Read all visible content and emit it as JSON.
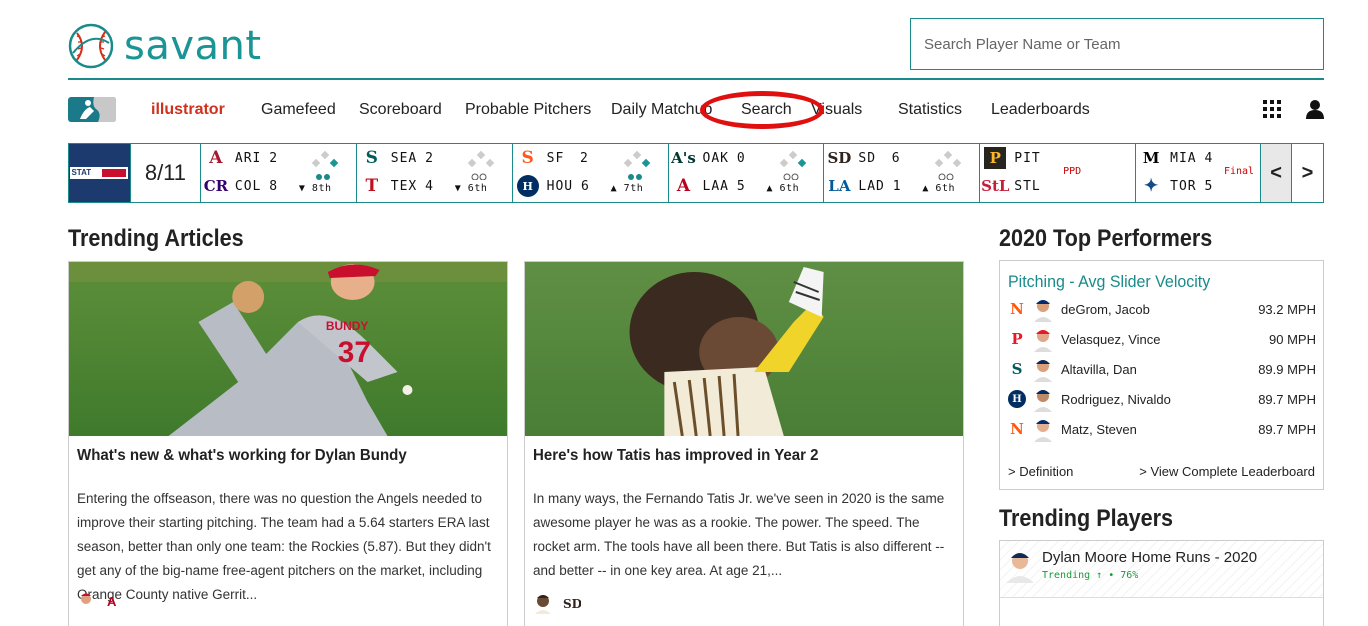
{
  "header": {
    "logo_text": "savant",
    "search_placeholder": "Search Player Name or Team"
  },
  "nav": {
    "items": [
      {
        "label": "illustrator",
        "active": true
      },
      {
        "label": "Gamefeed"
      },
      {
        "label": "Scoreboard"
      },
      {
        "label": "Probable Pitchers"
      },
      {
        "label": "Daily Matchup"
      },
      {
        "label": "Search",
        "highlighted": true
      },
      {
        "label": "Visuals"
      },
      {
        "label": "Statistics"
      },
      {
        "label": "Leaderboards"
      }
    ],
    "accent_color": "#d0301d",
    "highlight_color": "#e01010"
  },
  "scoreboard": {
    "date": "8/11",
    "games": [
      {
        "away": "ARI",
        "away_score": "2",
        "home": "COL",
        "home_score": "8",
        "inning": "▼ 8th"
      },
      {
        "away": "SEA",
        "away_score": "2",
        "home": "TEX",
        "home_score": "4",
        "inning": "▼ 6th"
      },
      {
        "away": "SF",
        "away_score": "2",
        "home": "HOU",
        "home_score": "6",
        "inning": "▲ 7th"
      },
      {
        "away": "OAK",
        "away_score": "0",
        "home": "LAA",
        "home_score": "5",
        "inning": "▲ 6th"
      },
      {
        "away": "SD",
        "away_score": "6",
        "home": "LAD",
        "home_score": "1",
        "inning": "▲ 6th"
      },
      {
        "away": "PIT",
        "away_score": "",
        "home": "STL",
        "home_score": "",
        "status": "PPD"
      },
      {
        "away": "MIA",
        "away_score": "4",
        "home": "TOR",
        "home_score": "5",
        "status": "Final"
      }
    ],
    "prev_label": "<",
    "next_label": ">"
  },
  "trending_articles": {
    "title": "Trending Articles",
    "articles": [
      {
        "title": "What's new & what's working for Dylan Bundy",
        "text": "Entering the offseason, there was no question the Angels needed to improve their starting pitching. The team had a 5.64 starters ERA last season, better than only one team: the Rockies (5.87). But they didn't get any of the big-name free-agent pitchers on the market, including Orange County native Gerrit...",
        "jersey_text": "BUNDY",
        "jersey_number": "37"
      },
      {
        "title": "Here's how Tatis has improved in Year 2",
        "text": "In many ways, the Fernando Tatis Jr. we've seen in 2020 is the same awesome player he was as a rookie. The power. The speed. The rocket arm. The tools have all been there. But Tatis is also different -- and better -- in one key area. At age 21,..."
      }
    ]
  },
  "top_performers": {
    "title": "2020 Top Performers",
    "metric": "Pitching - Avg Slider Velocity",
    "rows": [
      {
        "name": "deGrom, Jacob",
        "value": "93.2 MPH",
        "team_icon": "mets-icon"
      },
      {
        "name": "Velasquez, Vince",
        "value": "90 MPH",
        "team_icon": "phillies-icon"
      },
      {
        "name": "Altavilla, Dan",
        "value": "89.9 MPH",
        "team_icon": "mariners-icon"
      },
      {
        "name": "Rodriguez, Nivaldo",
        "value": "89.7 MPH",
        "team_icon": "astros-icon"
      },
      {
        "name": "Matz, Steven",
        "value": "89.7 MPH",
        "team_icon": "mets-icon"
      }
    ],
    "definition_link": "> Definition",
    "leaderboard_link": "> View Complete Leaderboard"
  },
  "trending_players": {
    "title": "Trending Players",
    "items": [
      {
        "name": "Dylan Moore Home Runs - 2020",
        "trend": "Trending ↑ • 76%"
      }
    ]
  }
}
